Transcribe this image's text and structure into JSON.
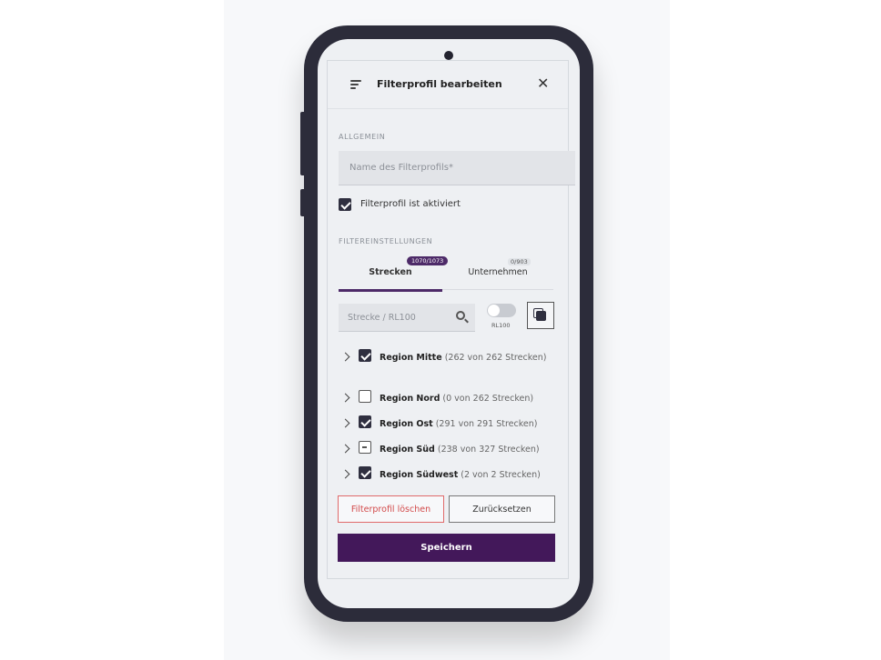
{
  "header": {
    "title": "Filterprofil bearbeiten"
  },
  "general": {
    "section_label": "ALLGEMEIN",
    "name_placeholder": "Name des Filterprofils*",
    "activate_label": "Filterprofil ist aktiviert",
    "activate_checked": true
  },
  "filters": {
    "section_label": "FILTEREINSTELLUNGEN",
    "tabs": [
      {
        "label": "Strecken",
        "badge": "1070/1073",
        "active": true
      },
      {
        "label": "Unternehmen",
        "badge": "0/903",
        "active": false
      }
    ],
    "search_placeholder": "Strecke / RL100",
    "toggle_label": "RL100",
    "toggle_on": false
  },
  "regions": [
    {
      "name": "Region Mitte",
      "count": "(262 von 262 Strecken)",
      "state": "checked"
    },
    {
      "name": "Region Nord",
      "count": "(0 von 262 Strecken)",
      "state": "empty"
    },
    {
      "name": "Region Ost",
      "count": "(291 von 291 Strecken)",
      "state": "checked"
    },
    {
      "name": "Region Süd",
      "count": "(238 von 327 Strecken)",
      "state": "indeterminate"
    },
    {
      "name": "Region Südwest",
      "count": "(2 von 2 Strecken)",
      "state": "checked"
    }
  ],
  "actions": {
    "delete_label": "Filterprofil löschen",
    "reset_label": "Zurücksetzen",
    "save_label": "Speichern"
  },
  "colors": {
    "brand_purple": "#43185a",
    "danger": "#d24a4a",
    "phone_frame": "#2c2c3a"
  }
}
